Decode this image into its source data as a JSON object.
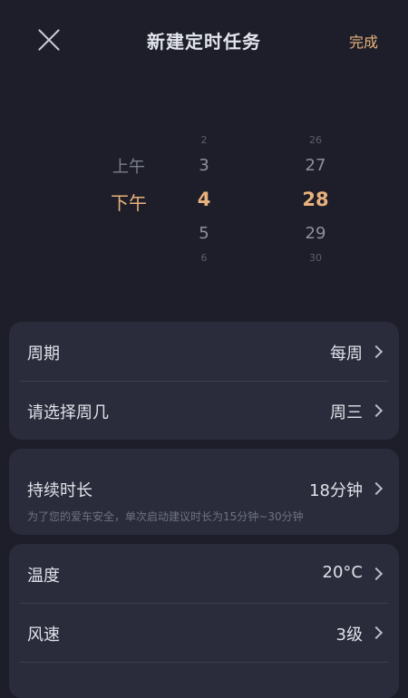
{
  "header": {
    "title": "新建定时任务",
    "done_label": "完成"
  },
  "picker": {
    "ampm": {
      "above": "上午",
      "selected": "下午"
    },
    "hour": {
      "far_above": "2",
      "above": "3",
      "selected": "4",
      "below": "5",
      "far_below": "6"
    },
    "minute": {
      "far_above": "26",
      "above": "27",
      "selected": "28",
      "below": "29",
      "far_below": "30"
    }
  },
  "schedule": {
    "cycle": {
      "label": "周期",
      "value": "每周"
    },
    "weekday": {
      "label": "请选择周几",
      "value": "周三"
    }
  },
  "duration": {
    "label": "持续时长",
    "value": "18分钟",
    "hint": "为了您的爱车安全，单次启动建议时长为15分钟~30分钟"
  },
  "climate": {
    "temperature": {
      "label": "温度",
      "value": "20°C"
    },
    "fan_speed": {
      "label": "风速",
      "value": "3级"
    }
  },
  "colors": {
    "accent": "#e9b27c",
    "background": "#1d1e29",
    "card": "#2a2c3b"
  },
  "icons": {
    "close": "close-icon",
    "chevron": "chevron-right-icon"
  }
}
